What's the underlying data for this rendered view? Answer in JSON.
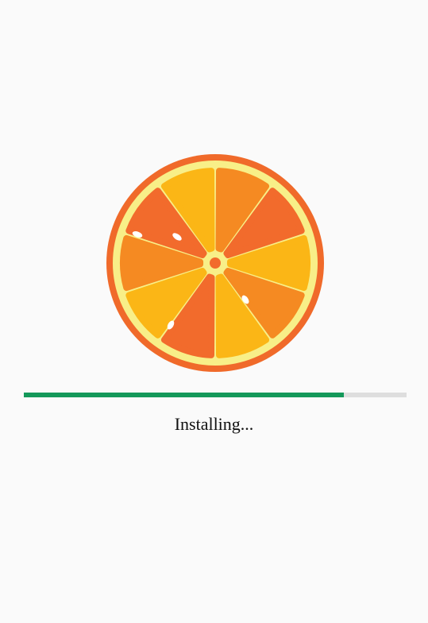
{
  "installer": {
    "logo_icon": "orange-slice-icon",
    "progress_fraction": 0.837,
    "status_text": "Installing...",
    "colors": {
      "background": "#fafafa",
      "progress_fill": "#14995a",
      "progress_track": "#dedede",
      "rind": "#f06a2a",
      "pith": "#f8ef88",
      "segment_dark": "#f26b2c",
      "segment_mid": "#f58a22",
      "segment_light": "#fbb616",
      "seed": "#ffffff"
    }
  }
}
